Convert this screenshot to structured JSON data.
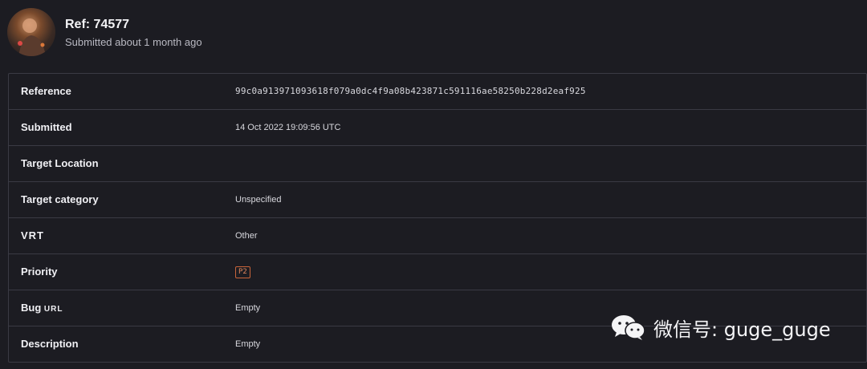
{
  "header": {
    "title": "Ref: 74577",
    "subtitle": "Submitted about 1 month ago"
  },
  "details": {
    "rows": [
      {
        "key": "Reference",
        "value": "99c0a913971093618f079a0dc4f9a08b423871c591116ae58250b228d2eaf925"
      },
      {
        "key": "Submitted",
        "value": "14 Oct 2022 19:09:56 UTC"
      },
      {
        "key": "Target Location",
        "value": ""
      },
      {
        "key": "Target category",
        "value": "Unspecified"
      },
      {
        "key": "VRT",
        "value": "Other"
      },
      {
        "key": "Priority",
        "value": "P2"
      },
      {
        "key_prefix": "Bug ",
        "key_suffix": "URL",
        "value": "Empty"
      },
      {
        "key": "Description",
        "value": "Empty"
      }
    ]
  },
  "watermark": {
    "text": "微信号: guge_guge",
    "icon": "wechat-icon"
  },
  "colors": {
    "background": "#1c1c22",
    "border": "#3a3a44",
    "priority": "#c8643a"
  }
}
